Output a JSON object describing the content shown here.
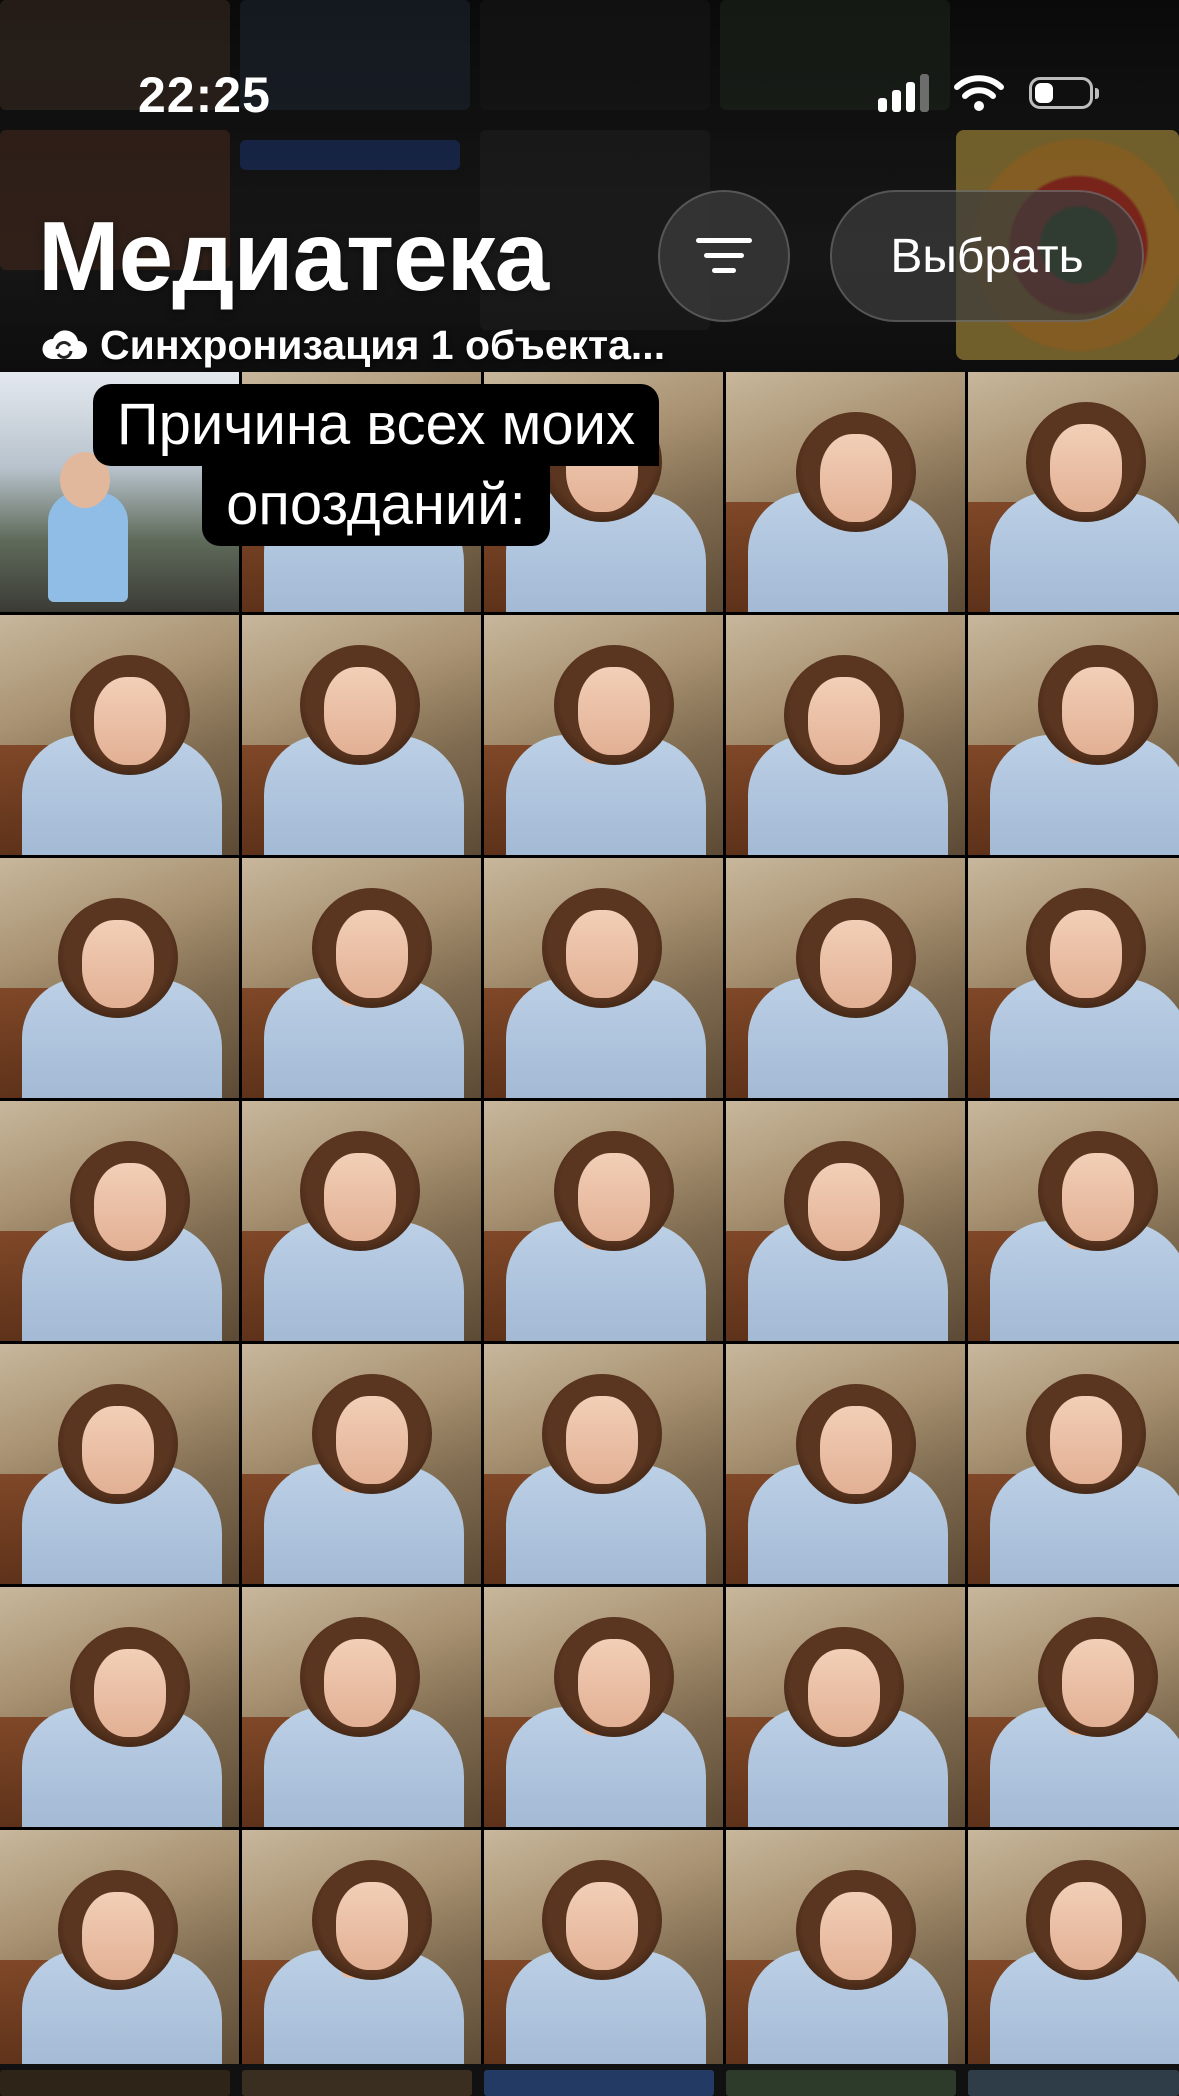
{
  "status_bar": {
    "time": "22:25",
    "signal_bars_active": 3,
    "signal_bars_total": 4,
    "battery_fraction": 0.35
  },
  "header": {
    "title": "Медиатека",
    "sync_status": "Синхронизация 1 объекта...",
    "select_button": "Выбрать",
    "sort_button_icon": "filter-lines-icon",
    "sync_icon": "cloud-sync-icon"
  },
  "caption": {
    "line1": "Причина всех моих",
    "line2": "опозданий:"
  },
  "grid": {
    "rows": 7,
    "columns": 5
  }
}
